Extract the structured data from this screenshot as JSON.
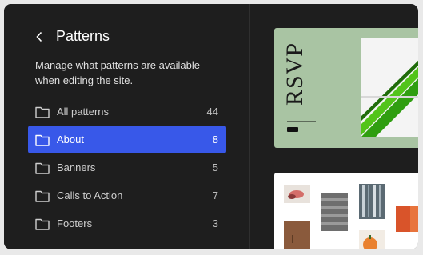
{
  "sidebar": {
    "title": "Patterns",
    "description": "Manage what patterns are available when editing the site.",
    "items": [
      {
        "label": "All patterns",
        "count": "44"
      },
      {
        "label": "About",
        "count": "8"
      },
      {
        "label": "Banners",
        "count": "5"
      },
      {
        "label": "Calls to Action",
        "count": "7"
      },
      {
        "label": "Footers",
        "count": "3"
      }
    ],
    "active_index": 1
  },
  "preview": {
    "rsvp_title": "RSVP"
  },
  "colors": {
    "background": "#1e1e1e",
    "accent": "#3858e9",
    "card_green": "#a9c4a3"
  },
  "icons": {
    "back": "chevron-left-icon",
    "folder": "folder-icon"
  }
}
